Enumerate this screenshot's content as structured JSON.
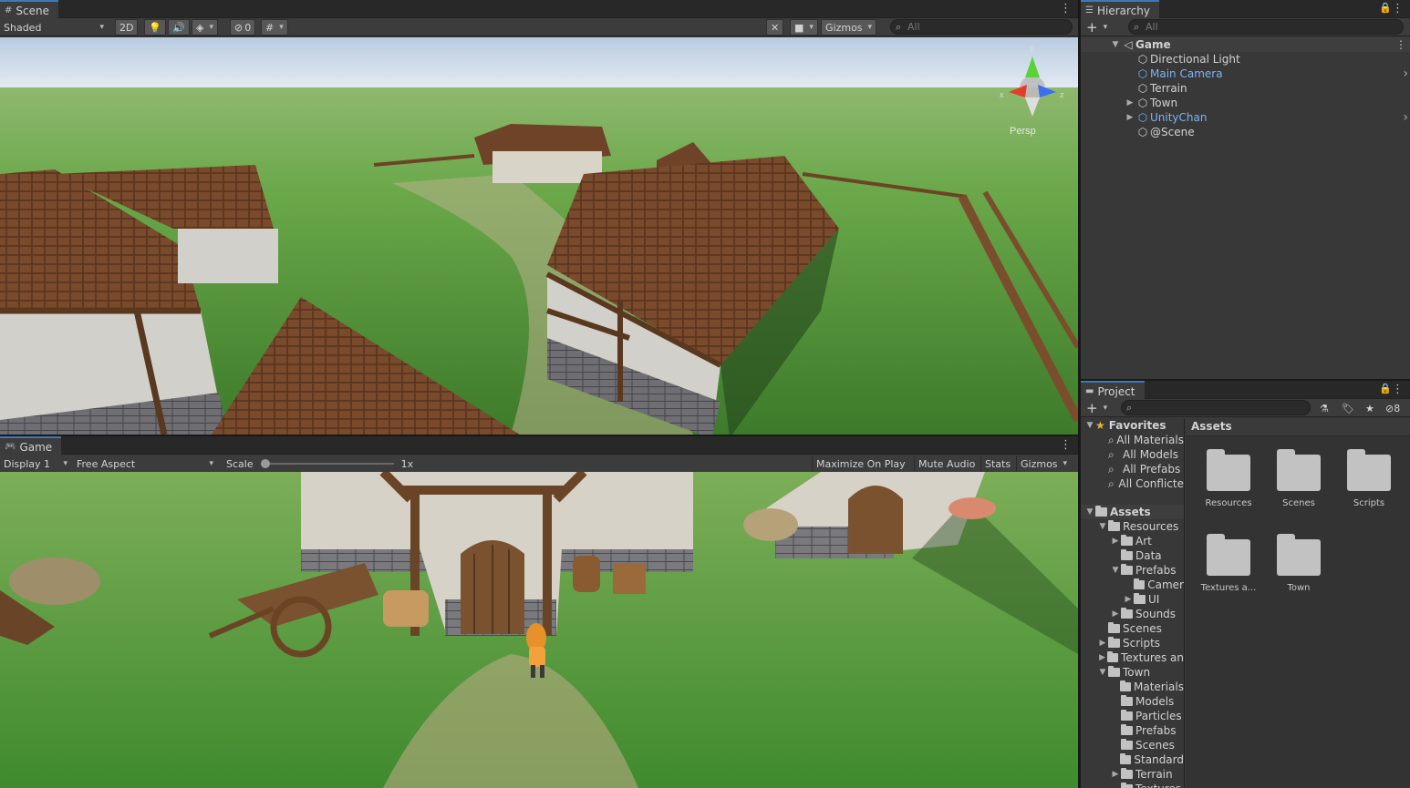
{
  "scene": {
    "tab": "Scene",
    "shading": "Shaded",
    "btn_2d": "2D",
    "hidden_count": "0",
    "gizmos": "Gizmos",
    "search_placeholder": "All",
    "persp": "Persp",
    "gizmo_axes": {
      "y": "y",
      "x": "x",
      "z": "z"
    }
  },
  "game": {
    "tab": "Game",
    "display": "Display 1",
    "aspect": "Free Aspect",
    "scale_label": "Scale",
    "scale_value": "1x",
    "scale_level": 0.0,
    "maximize": "Maximize On Play",
    "mute": "Mute Audio",
    "stats": "Stats",
    "gizmos": "Gizmos"
  },
  "hierarchy": {
    "tab": "Hierarchy",
    "search_placeholder": "All",
    "scene_name": "Game",
    "items": [
      {
        "label": "Directional Light",
        "blue": false,
        "expandable": false
      },
      {
        "label": "Main Camera",
        "blue": true,
        "expandable": false
      },
      {
        "label": "Terrain",
        "blue": false,
        "expandable": false
      },
      {
        "label": "Town",
        "blue": false,
        "expandable": true
      },
      {
        "label": "UnityChan",
        "blue": true,
        "expandable": true
      },
      {
        "label": "@Scene",
        "blue": false,
        "expandable": false
      }
    ]
  },
  "project": {
    "tab": "Project",
    "hidden_count": "8",
    "favorites_label": "Favorites",
    "favorites": [
      "All Materials",
      "All Models",
      "All Prefabs",
      "All Conflicte"
    ],
    "assets_label": "Assets",
    "tree": [
      {
        "label": "Resources",
        "depth": 1,
        "state": "open"
      },
      {
        "label": "Art",
        "depth": 2,
        "state": "closed"
      },
      {
        "label": "Data",
        "depth": 2,
        "state": "none"
      },
      {
        "label": "Prefabs",
        "depth": 2,
        "state": "open"
      },
      {
        "label": "Camer",
        "depth": 3,
        "state": "none"
      },
      {
        "label": "UI",
        "depth": 3,
        "state": "closed"
      },
      {
        "label": "Sounds",
        "depth": 2,
        "state": "closed"
      },
      {
        "label": "Scenes",
        "depth": 1,
        "state": "none"
      },
      {
        "label": "Scripts",
        "depth": 1,
        "state": "closed"
      },
      {
        "label": "Textures an",
        "depth": 1,
        "state": "closed"
      },
      {
        "label": "Town",
        "depth": 1,
        "state": "open"
      },
      {
        "label": "Materials",
        "depth": 2,
        "state": "none"
      },
      {
        "label": "Models",
        "depth": 2,
        "state": "none"
      },
      {
        "label": "Particles",
        "depth": 2,
        "state": "none"
      },
      {
        "label": "Prefabs",
        "depth": 2,
        "state": "none"
      },
      {
        "label": "Scenes",
        "depth": 2,
        "state": "none"
      },
      {
        "label": "Standard",
        "depth": 2,
        "state": "none"
      },
      {
        "label": "Terrain",
        "depth": 2,
        "state": "closed"
      },
      {
        "label": "Textures",
        "depth": 2,
        "state": "none"
      }
    ],
    "breadcrumb": "Assets",
    "grid": [
      "Resources",
      "Scenes",
      "Scripts",
      "Textures a...",
      "Town"
    ]
  }
}
